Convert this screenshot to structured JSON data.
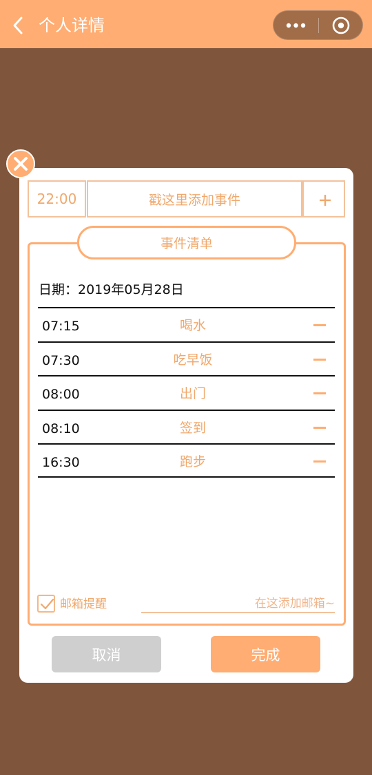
{
  "nav": {
    "title": "个人详情",
    "back_icon": "chevron-left-icon",
    "capsule": {
      "more_icon": "more-dots-icon",
      "close_icon": "target-circle-icon"
    }
  },
  "input": {
    "time": "22:00",
    "event_placeholder": "戳这里添加事件",
    "add_icon": "plus-icon"
  },
  "list": {
    "title": "事件清单",
    "date_text": "日期：2019年05月28日",
    "events": [
      {
        "time": "07:15",
        "name": "喝水"
      },
      {
        "time": "07:30",
        "name": "吃早饭"
      },
      {
        "time": "08:00",
        "name": "出门"
      },
      {
        "time": "08:10",
        "name": "签到"
      },
      {
        "time": "16:30",
        "name": "跑步"
      }
    ]
  },
  "email": {
    "checked": true,
    "label": "邮箱提醒",
    "placeholder": "在这添加邮箱~"
  },
  "buttons": {
    "cancel": "取消",
    "done": "完成"
  },
  "colors": {
    "accent": "#ffad72",
    "background": "#7f563c",
    "text_accent": "#f0a86c",
    "cancel_gray": "#cfcfcf"
  }
}
